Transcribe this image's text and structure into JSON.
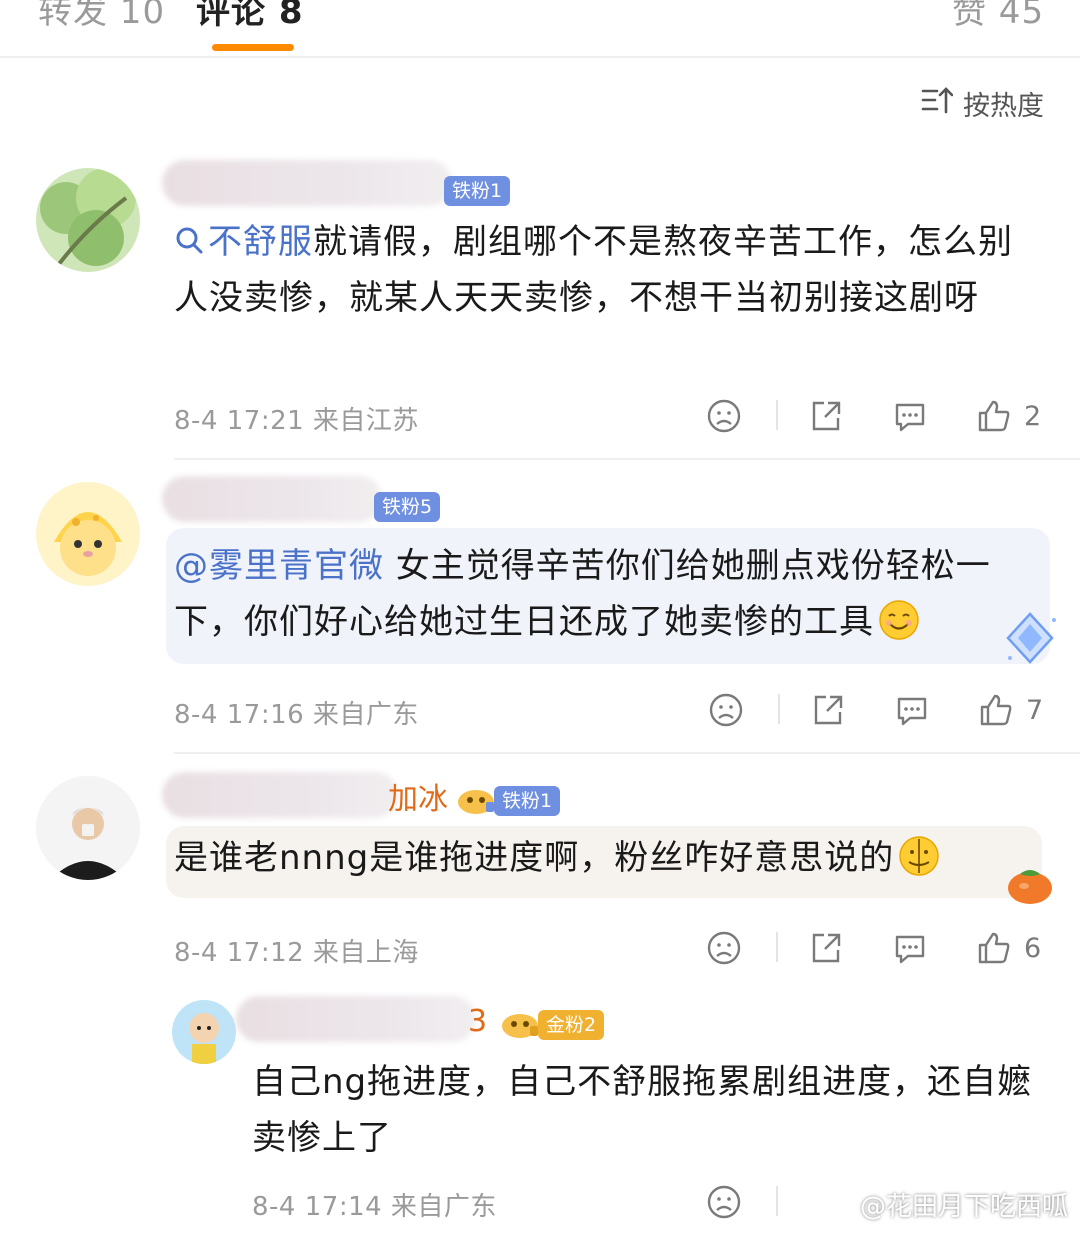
{
  "tabs": [
    {
      "label": "转发 10"
    },
    {
      "label": "评论 8"
    },
    {
      "label": "赞 45"
    }
  ],
  "sort_label": "按热度",
  "colors": {
    "accent": "#ff8a00",
    "link": "#4a72c8",
    "badge_blue": "#6f8fe0",
    "badge_gold": "#f0b030"
  },
  "comments": [
    {
      "name_tail": "",
      "badge": "铁粉1",
      "text_link": "不舒服",
      "text": "就请假，剧组哪个不是熬夜辛苦工作，怎么别人没卖惨，就某人天天卖惨，不想干当初别接这剧呀",
      "meta": "8-4 17:21 来自江苏",
      "likes": "2"
    },
    {
      "name_tail": "",
      "badge": "铁粉5",
      "text_link": "@雾里青官微",
      "text": " 女主觉得辛苦你们给她删点戏份轻松一下，你们好心给她过生日还成了她卖惨的工具",
      "meta": "8-4 17:16 来自广东",
      "likes": "7"
    },
    {
      "name_tail": "加冰",
      "badge": "铁粉1",
      "text": "是谁老nnng是谁拖进度啊，粉丝咋好意思说的",
      "meta": "8-4 17:12 来自上海",
      "likes": "6"
    },
    {
      "name_tail": "3",
      "badge": "金粉2",
      "text": "自己ng拖进度，自己不舒服拖累剧组进度，还自嬷卖惨上了",
      "meta": "8-4 17:14 来自广东"
    }
  ],
  "watermark": "@花田月下吃西呱"
}
